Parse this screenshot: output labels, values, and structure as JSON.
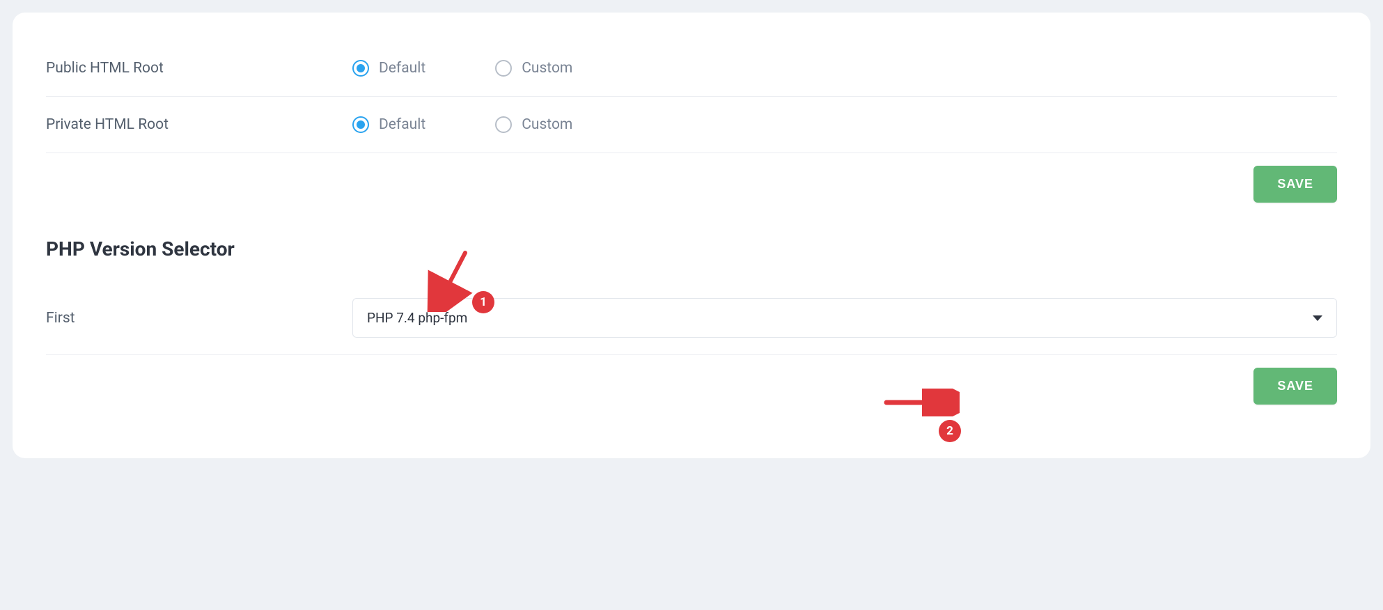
{
  "rows": {
    "public_html_root": {
      "label": "Public HTML Root",
      "options": {
        "default": "Default",
        "custom": "Custom"
      }
    },
    "private_html_root": {
      "label": "Private HTML Root",
      "options": {
        "default": "Default",
        "custom": "Custom"
      }
    }
  },
  "save_button_1": "SAVE",
  "php_section": {
    "title": "PHP Version Selector",
    "first_label": "First",
    "first_value": "PHP 7.4 php-fpm"
  },
  "save_button_2": "SAVE",
  "annotations": {
    "badge1": "1",
    "badge2": "2"
  }
}
